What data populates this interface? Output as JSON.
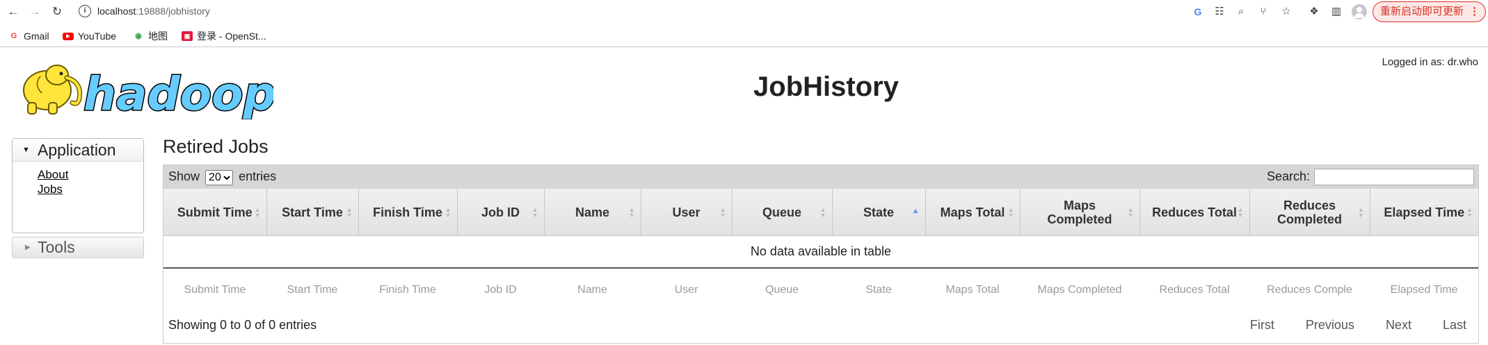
{
  "browser": {
    "url_host": "localhost",
    "url_rest": ":19888/jobhistory",
    "update_label": "重新启动即可更新",
    "bookmarks": [
      {
        "label": "Gmail"
      },
      {
        "label": "YouTube"
      },
      {
        "label": "地图"
      },
      {
        "label": "登录 - OpenSt..."
      }
    ]
  },
  "page": {
    "logo_text": "hadoop",
    "title": "JobHistory",
    "logged_in": "Logged in as: dr.who"
  },
  "sidebar": {
    "application_label": "Application",
    "links": [
      {
        "label": "About"
      },
      {
        "label": "Jobs"
      }
    ],
    "tools_label": "Tools"
  },
  "main": {
    "section_title": "Retired Jobs",
    "show_label": "Show",
    "entries_label": "entries",
    "page_size": "20",
    "page_size_options": [
      "20"
    ],
    "search_label": "Search:",
    "search_value": "",
    "columns": [
      {
        "label": "Submit Time",
        "short": "Submit Time"
      },
      {
        "label": "Start Time",
        "short": "Start Time"
      },
      {
        "label": "Finish Time",
        "short": "Finish Time"
      },
      {
        "label": "Job ID",
        "short": "Job ID"
      },
      {
        "label": "Name",
        "short": "Name"
      },
      {
        "label": "User",
        "short": "User"
      },
      {
        "label": "Queue",
        "short": "Queue"
      },
      {
        "label": "State",
        "short": "State"
      },
      {
        "label": "Maps Total",
        "short": "Maps Total"
      },
      {
        "label": "Maps Completed",
        "short": "Maps Completed"
      },
      {
        "label": "Reduces Total",
        "short": "Reduces Total"
      },
      {
        "label": "Reduces Completed",
        "short": "Reduces Comple"
      },
      {
        "label": "Elapsed Time",
        "short": "Elapsed Time"
      }
    ],
    "empty_text": "No data available in table",
    "info_text": "Showing 0 to 0 of 0 entries",
    "pagination": {
      "first": "First",
      "previous": "Previous",
      "next": "Next",
      "last": "Last"
    },
    "colors": {
      "sort_active": "#6f8ff0"
    }
  }
}
